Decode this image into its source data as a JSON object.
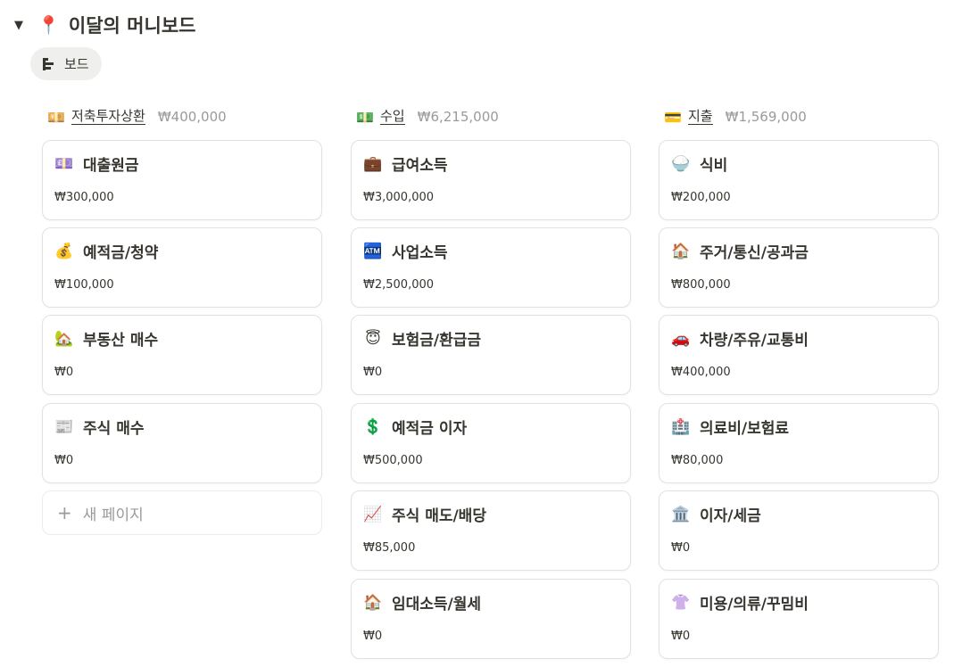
{
  "header": {
    "toggle": "▼",
    "title_emoji": "📍",
    "title": "이달의 머니보드"
  },
  "view": {
    "icon": "board-view-icon",
    "label": "보드"
  },
  "columns": [
    {
      "emoji": "💴",
      "icon": "yen-banknote-icon",
      "name": "저축투자상환",
      "total": "₩400,000",
      "cards": [
        {
          "emoji": "💷",
          "icon": "pound-banknote-icon",
          "title": "대출원금",
          "amount": "₩300,000"
        },
        {
          "emoji": "💰",
          "icon": "money-bag-icon",
          "title": "예적금/청약",
          "amount": "₩100,000"
        },
        {
          "emoji": "🏡",
          "icon": "house-icon",
          "title": "부동산 매수",
          "amount": "₩0"
        },
        {
          "emoji": "📰",
          "icon": "newspaper-icon",
          "title": "주식 매수",
          "amount": "₩0"
        }
      ],
      "new_page": "새 페이지"
    },
    {
      "emoji": "💵",
      "icon": "dollar-banknote-icon",
      "name": "수입",
      "total": "₩6,215,000",
      "cards": [
        {
          "emoji": "💼",
          "icon": "briefcase-icon",
          "title": "급여소득",
          "amount": "₩3,000,000"
        },
        {
          "emoji": "🏧",
          "icon": "atm-icon",
          "title": "사업소득",
          "amount": "₩2,500,000"
        },
        {
          "emoji": "😇",
          "icon": "angel-face-icon",
          "title": "보험금/환급금",
          "amount": "₩0"
        },
        {
          "emoji": "💲",
          "icon": "dollar-sign-icon",
          "title": "예적금 이자",
          "amount": "₩500,000"
        },
        {
          "emoji": "📈",
          "icon": "chart-up-icon",
          "title": "주식 매도/배당",
          "amount": "₩85,000"
        },
        {
          "emoji": "🏠",
          "icon": "home-icon",
          "title": "임대소득/월세",
          "amount": "₩0"
        }
      ]
    },
    {
      "emoji": "💳",
      "icon": "credit-card-icon",
      "name": "지출",
      "total": "₩1,569,000",
      "cards": [
        {
          "emoji": "🍚",
          "icon": "rice-bowl-icon",
          "title": "식비",
          "amount": "₩200,000"
        },
        {
          "emoji": "🏠",
          "icon": "home-icon",
          "title": "주거/통신/공과금",
          "amount": "₩800,000"
        },
        {
          "emoji": "🚗",
          "icon": "car-icon",
          "title": "차량/주유/교통비",
          "amount": "₩400,000"
        },
        {
          "emoji": "🏥",
          "icon": "hospital-icon",
          "title": "의료비/보험료",
          "amount": "₩80,000"
        },
        {
          "emoji": "🏛️",
          "icon": "classical-building-icon",
          "title": "이자/세금",
          "amount": "₩0"
        },
        {
          "emoji": "👚",
          "icon": "blouse-icon",
          "title": "미용/의류/꾸밈비",
          "amount": "₩0"
        }
      ]
    }
  ]
}
